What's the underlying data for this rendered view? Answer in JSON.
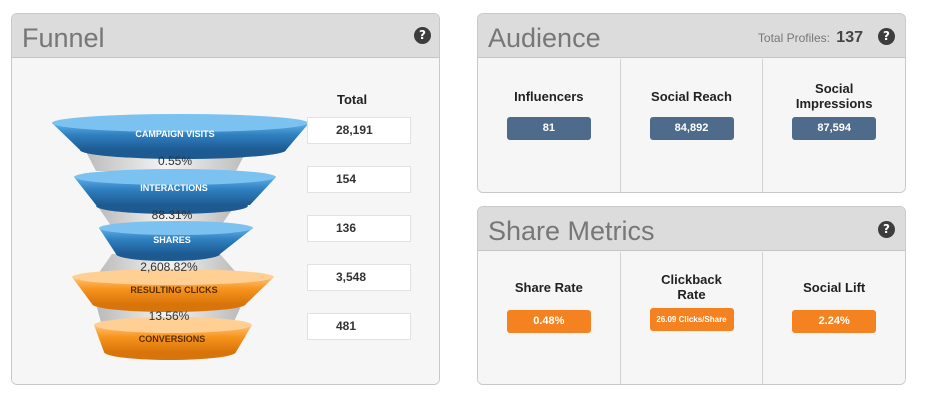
{
  "funnel": {
    "title": "Funnel",
    "total_header": "Total",
    "stages": [
      {
        "label": "CAMPAIGN VISITS",
        "total": "28,191",
        "color": "blue"
      },
      {
        "label": "INTERACTIONS",
        "total": "154",
        "color": "blue"
      },
      {
        "label": "SHARES",
        "total": "136",
        "color": "blue"
      },
      {
        "label": "RESULTING CLICKS",
        "total": "3,548",
        "color": "orange"
      },
      {
        "label": "CONVERSIONS",
        "total": "481",
        "color": "orange"
      }
    ],
    "rates": [
      "0.55%",
      "88.31%",
      "2,608.82%",
      "13.56%"
    ]
  },
  "audience": {
    "title": "Audience",
    "total_profiles_label": "Total Profiles:",
    "total_profiles_value": "137",
    "metrics": [
      {
        "label": "Influencers",
        "value": "81"
      },
      {
        "label": "Social Reach",
        "value": "84,892"
      },
      {
        "label": "Social Impressions",
        "value": "87,594"
      }
    ]
  },
  "share_metrics": {
    "title": "Share Metrics",
    "metrics": [
      {
        "label": "Share Rate",
        "value": "0.48%"
      },
      {
        "label": "Clickback Rate",
        "value": "26.09 Clicks/Share"
      },
      {
        "label": "Social Lift",
        "value": "2.24%"
      }
    ]
  },
  "help_icon_glyph": "?",
  "colors": {
    "funnel_blue": "#2f7fbf",
    "funnel_orange": "#f7941d",
    "badge_blue": "#4e6b8c",
    "badge_orange": "#f58220",
    "panel_header": "#dcdcdc"
  }
}
